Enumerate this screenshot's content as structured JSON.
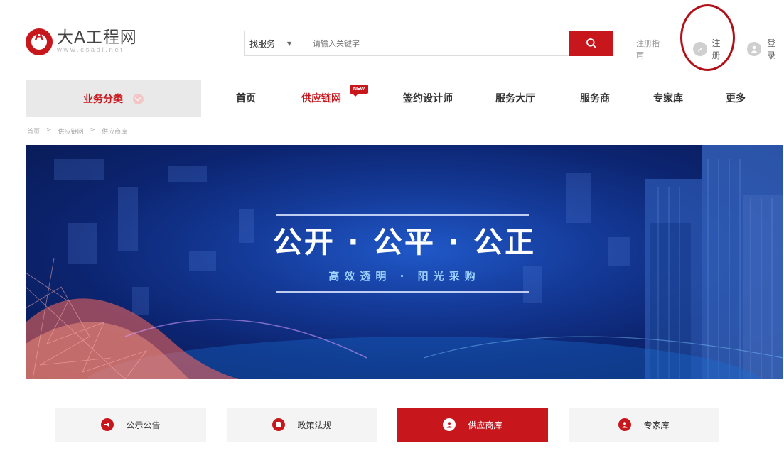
{
  "logo": {
    "name": "大A工程网",
    "url": "www.csadi.net"
  },
  "search": {
    "type_label": "找服务",
    "placeholder": "请输入关键字"
  },
  "user": {
    "guide": "注册指南",
    "register": "注册",
    "login": "登录"
  },
  "nav": {
    "category_label": "业务分类",
    "items": [
      "首页",
      "供应链网",
      "签约设计师",
      "服务大厅",
      "服务商",
      "专家库",
      "更多"
    ],
    "badge": "NEW"
  },
  "breadcrumb": [
    "首页",
    "供应链网",
    "供应商库"
  ],
  "breadcrumb_sep": ">",
  "banner": {
    "title": "公开 · 公平 · 公正",
    "subtitle": "高效透明 · 阳光采购"
  },
  "tabs": [
    {
      "label": "公示公告",
      "icon": "megaphone-icon"
    },
    {
      "label": "政策法规",
      "icon": "document-icon"
    },
    {
      "label": "供应商库",
      "icon": "user-icon",
      "active": true
    },
    {
      "label": "专家库",
      "icon": "expert-icon"
    }
  ],
  "colors": {
    "accent": "#c8161d",
    "banner_dark": "#081a52",
    "banner_light": "#2058c8",
    "highlight": "#b01018"
  }
}
